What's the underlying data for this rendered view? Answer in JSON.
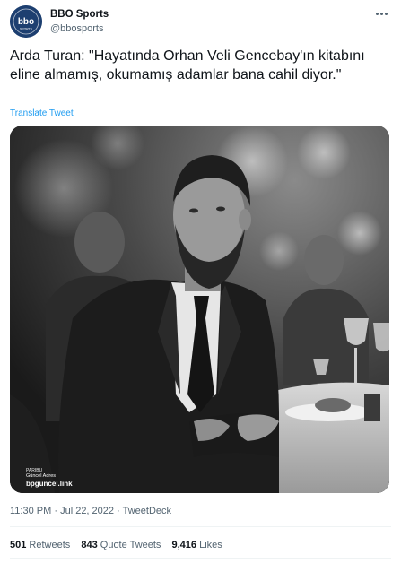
{
  "author": {
    "display_name": "BBO Sports",
    "handle": "@bbosports",
    "avatar_text": "bbo",
    "avatar_subtext": "SPORTS"
  },
  "tweet": {
    "text": "Arda Turan: \"Hayatında Orhan Veli Gencebay'ın kitabını eline almamış, okumamış adamlar bana cahil diyor.\"",
    "translate_label": "Translate Tweet"
  },
  "media": {
    "watermark": {
      "brand": "PARIBU",
      "caption": "Güncel Adres",
      "url": "bpguncel.link"
    }
  },
  "meta": {
    "time": "11:30 PM",
    "date": "Jul 22, 2022",
    "source": "TweetDeck",
    "separator": "·"
  },
  "stats": {
    "retweets_count": "501",
    "retweets_label": "Retweets",
    "quotes_count": "843",
    "quotes_label": "Quote Tweets",
    "likes_count": "9,416",
    "likes_label": "Likes"
  },
  "colors": {
    "avatar_bg": "#1d3f70",
    "link": "#1d9bf0",
    "muted": "#536471"
  }
}
